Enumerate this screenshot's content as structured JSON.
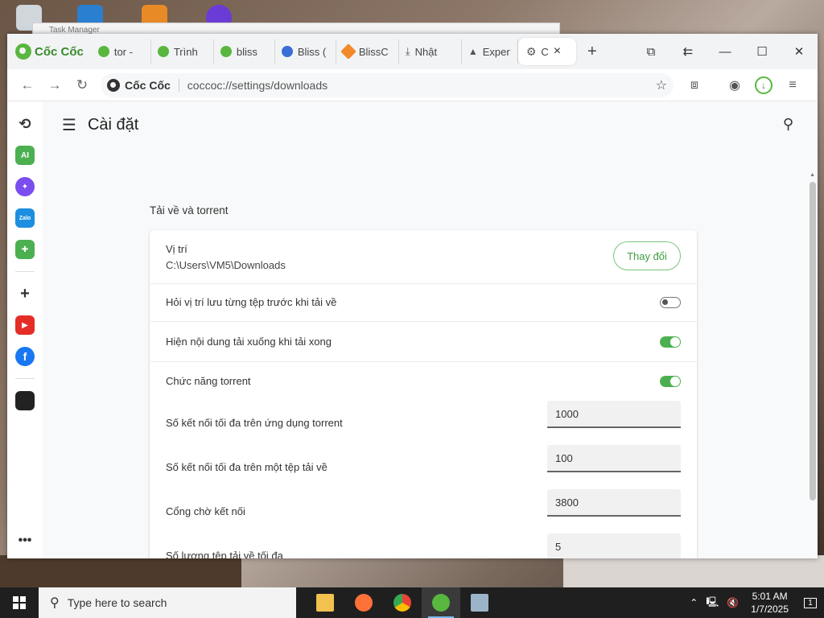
{
  "background_window": {
    "title": "Task Manager"
  },
  "browser": {
    "brand": "Cốc Cốc",
    "tabs": [
      {
        "label": "tor -",
        "color": "#59b73f"
      },
      {
        "label": "Trình",
        "color": "#59b73f"
      },
      {
        "label": "bliss",
        "color": "#59b73f"
      },
      {
        "label": "Bliss (",
        "color": "#3a6fd8"
      },
      {
        "label": "BlissC",
        "color": "#f28a2b"
      },
      {
        "label": "Nhật",
        "color": "#555555"
      },
      {
        "label": "Exper",
        "color": "#555555"
      },
      {
        "label": "C",
        "color": "#555555"
      }
    ],
    "omnibox": {
      "brand": "Cốc Cốc",
      "url": "coccoc://settings/downloads"
    }
  },
  "settings": {
    "page_title": "Cài đặt",
    "section_title": "Tải về và torrent",
    "location": {
      "label": "Vị trí",
      "path": "C:\\Users\\VM5\\Downloads",
      "button": "Thay đổi"
    },
    "ask_location": {
      "label": "Hỏi vị trí lưu từng tệp trước khi tải về",
      "enabled": false
    },
    "show_downloads": {
      "label": "Hiện nội dung tải xuống khi tải xong",
      "enabled": true
    },
    "torrent": {
      "label": "Chức năng torrent",
      "enabled": true
    },
    "max_conn_app": {
      "label": "Số kết nối tối đa trên ứng dụng torrent",
      "value": "1000"
    },
    "max_conn_file": {
      "label": "Số kết nối tối đa trên một tệp tải về",
      "value": "100"
    },
    "listen_port": {
      "label": "Cổng chờ kết nối",
      "value": "3800"
    },
    "max_downloads": {
      "label": "Số lượng tệp tải về tối đa",
      "value": "5"
    }
  },
  "taskbar": {
    "search_placeholder": "Type here to search",
    "time": "5:01 AM",
    "date": "1/7/2025",
    "notifications": "1"
  },
  "colors": {
    "accent": "#4cb050",
    "brand": "#59b73f",
    "taskbar": "#1f1f1f"
  }
}
